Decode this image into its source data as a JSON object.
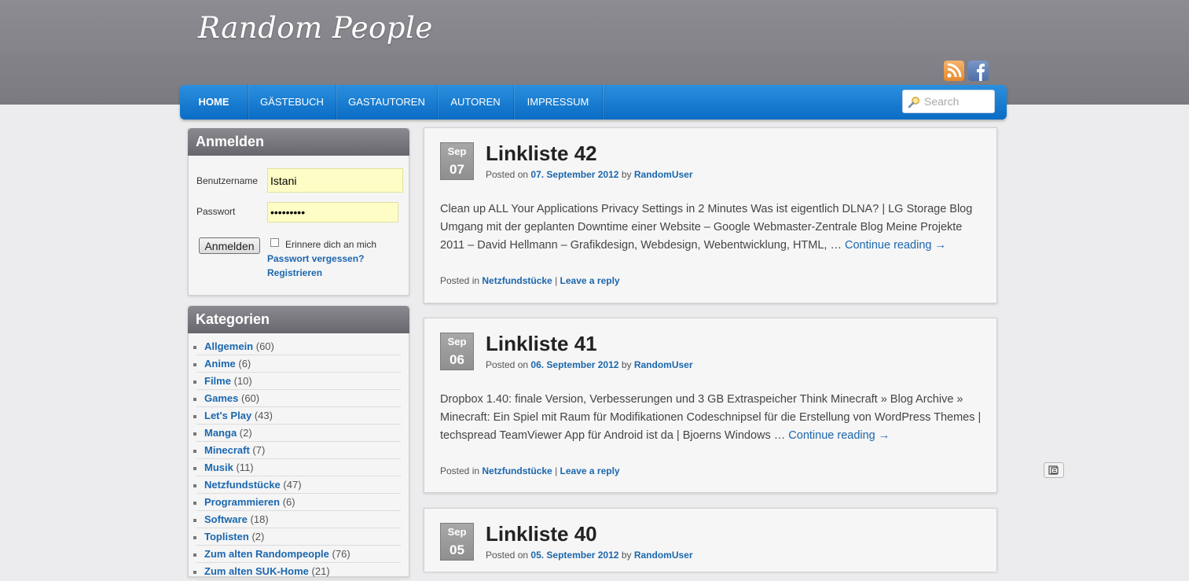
{
  "site": {
    "title": "Random People"
  },
  "social": [
    {
      "icon": "rss-icon",
      "label": "RSS"
    },
    {
      "icon": "facebook-icon",
      "label": "Facebook"
    }
  ],
  "nav": {
    "items": [
      {
        "label": "HOME",
        "active": true
      },
      {
        "label": "GÄSTEBUCH",
        "active": false
      },
      {
        "label": "GASTAUTOREN",
        "active": false
      },
      {
        "label": "AUTOREN",
        "active": false
      },
      {
        "label": "IMPRESSUM",
        "active": false
      }
    ],
    "search_placeholder": "Search"
  },
  "login": {
    "title": "Anmelden",
    "username_label": "Benutzername",
    "username_value": "Istani",
    "password_label": "Passwort",
    "password_value": "•••••••••",
    "button_label": "Anmelden",
    "remember_label": "Erinnere dich an mich",
    "forgot_link": "Passwort vergessen?",
    "register_link": "Registrieren"
  },
  "categories": {
    "title": "Kategorien",
    "items": [
      {
        "name": "Allgemein",
        "count": "(60)"
      },
      {
        "name": "Anime",
        "count": "(6)"
      },
      {
        "name": "Filme",
        "count": "(10)"
      },
      {
        "name": "Games",
        "count": "(60)"
      },
      {
        "name": "Let's Play",
        "count": "(43)"
      },
      {
        "name": "Manga",
        "count": "(2)"
      },
      {
        "name": "Minecraft",
        "count": "(7)"
      },
      {
        "name": "Musik",
        "count": "(11)"
      },
      {
        "name": "Netzfundstücke",
        "count": "(47)"
      },
      {
        "name": "Programmieren",
        "count": "(6)"
      },
      {
        "name": "Software",
        "count": "(18)"
      },
      {
        "name": "Toplisten",
        "count": "(2)"
      },
      {
        "name": "Zum alten Randompeople",
        "count": "(76)"
      },
      {
        "name": "Zum alten SUK-Home",
        "count": "(21)"
      }
    ]
  },
  "posts": [
    {
      "month": "Sep",
      "day": "07",
      "title": "Linkliste 42",
      "posted_on": "Posted on",
      "date": "07. September 2012",
      "by": "by",
      "author": "RandomUser",
      "excerpt": "Clean up ALL Your Applications Privacy Settings in 2 Minutes Was ist eigentlich DLNA? | LG Storage Blog Umgang mit der geplanten Downtime einer Website – Google Webmaster-Zentrale Blog Meine Projekte 2011 – David Hellmann – Grafikdesign, Webdesign, Webentwicklung, HTML, … ",
      "continue": "Continue reading →",
      "posted_in": "Posted in",
      "category": "Netzfundstücke",
      "separator": "|",
      "reply": "Leave a reply"
    },
    {
      "month": "Sep",
      "day": "06",
      "title": "Linkliste 41",
      "posted_on": "Posted on",
      "date": "06. September 2012",
      "by": "by",
      "author": "RandomUser",
      "excerpt": "Dropbox 1.40: finale Version, Verbesserungen und 3 GB Extraspeicher Think Minecraft » Blog Archive » Minecraft: Ein Spiel mit Raum für Modifikationen Codeschnipsel für die Erstellung von WordPress Themes | techspread TeamViewer App für Android ist da | Bjoerns Windows … ",
      "continue": "Continue reading →",
      "posted_in": "Posted in",
      "category": "Netzfundstücke",
      "separator": "|",
      "reply": "Leave a reply"
    },
    {
      "month": "Sep",
      "day": "05",
      "title": "Linkliste 40",
      "posted_on": "Posted on",
      "date": "05. September 2012",
      "by": "by",
      "author": "RandomUser"
    }
  ],
  "colors": {
    "link": "#1b67ae",
    "nav": "#0a6cc4",
    "header": "#808086"
  }
}
